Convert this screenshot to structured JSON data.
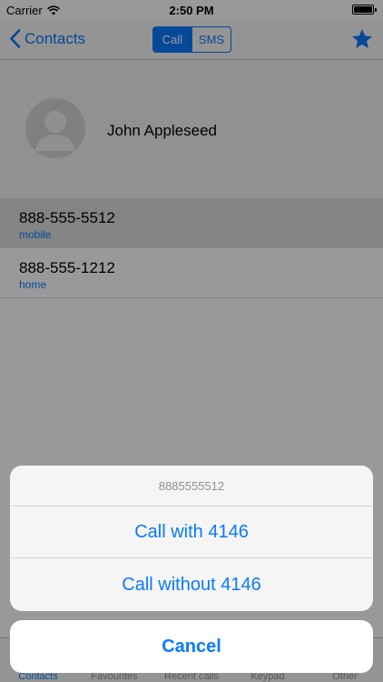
{
  "status_bar": {
    "carrier": "Carrier",
    "time": "2:50 PM"
  },
  "nav": {
    "back_label": "Contacts",
    "segments": [
      "Call",
      "SMS"
    ],
    "selected_segment": "Call",
    "star_icon": "star-icon"
  },
  "contact": {
    "name": "John Appleseed"
  },
  "phones": [
    {
      "number": "888-555-5512",
      "label": "mobile"
    },
    {
      "number": "888-555-1212",
      "label": "home"
    }
  ],
  "tabs": [
    "Contacts",
    "Favourites",
    "Recent calls",
    "Keypad",
    "Other"
  ],
  "action_sheet": {
    "title": "8885555512",
    "actions": [
      "Call with 4146",
      "Call without 4146"
    ],
    "cancel": "Cancel"
  },
  "colors": {
    "accent": "#0a7aff",
    "dim": "rgba(0,0,0,0.40)"
  }
}
